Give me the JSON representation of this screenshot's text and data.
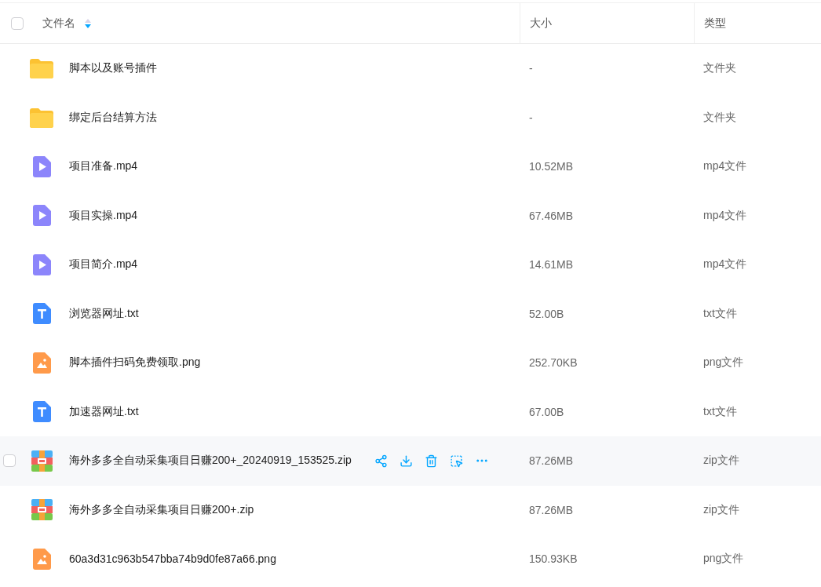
{
  "header": {
    "checked": false,
    "columns": [
      {
        "label": "文件名",
        "sorted": true,
        "descending": true
      },
      {
        "label": "大小"
      },
      {
        "label": "类型"
      }
    ]
  },
  "rows": [
    {
      "kind": "folder",
      "name": "脚本以及账号插件",
      "size": "-",
      "type": "文件夹",
      "hovered": false
    },
    {
      "kind": "folder",
      "name": "绑定后台结算方法",
      "size": "-",
      "type": "文件夹",
      "hovered": false
    },
    {
      "kind": "video",
      "name": "项目准备.mp4",
      "size": "10.52MB",
      "type": "mp4文件",
      "hovered": false
    },
    {
      "kind": "video",
      "name": "项目实操.mp4",
      "size": "67.46MB",
      "type": "mp4文件",
      "hovered": false
    },
    {
      "kind": "video",
      "name": "项目简介.mp4",
      "size": "14.61MB",
      "type": "mp4文件",
      "hovered": false
    },
    {
      "kind": "text",
      "name": "浏览器网址.txt",
      "size": "52.00B",
      "type": "txt文件",
      "hovered": false
    },
    {
      "kind": "image",
      "name": "脚本插件扫码免费领取.png",
      "size": "252.70KB",
      "type": "png文件",
      "hovered": false
    },
    {
      "kind": "text",
      "name": "加速器网址.txt",
      "size": "67.00B",
      "type": "txt文件",
      "hovered": false
    },
    {
      "kind": "archive",
      "name": "海外多多全自动采集项目日赚200+_20240919_153525.zip",
      "size": "87.26MB",
      "type": "zip文件",
      "hovered": true,
      "checked": false
    },
    {
      "kind": "archive",
      "name": "海外多多全自动采集项目日赚200+.zip",
      "size": "87.26MB",
      "type": "zip文件",
      "hovered": false
    },
    {
      "kind": "image",
      "name": "60a3d31c963b547bba74b9d0fe87a66.png",
      "size": "150.93KB",
      "type": "png文件",
      "hovered": false
    }
  ]
}
